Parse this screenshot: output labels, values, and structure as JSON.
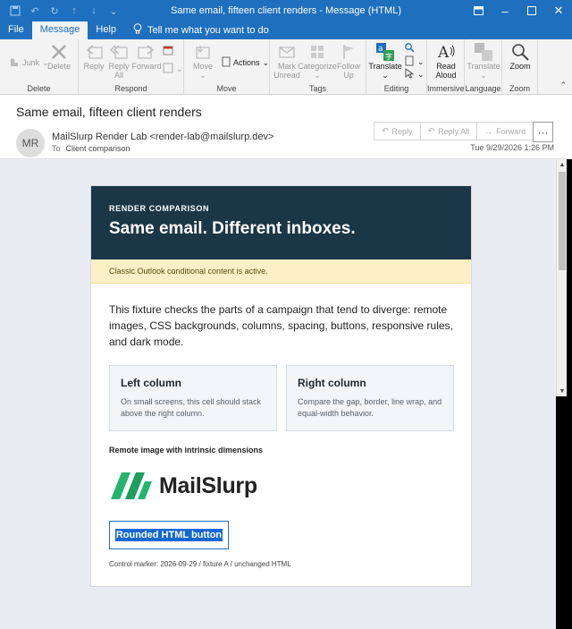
{
  "window": {
    "title": "Same email, fifteen client renders  -  Message (HTML)"
  },
  "menu_tabs": [
    {
      "label": "File",
      "active": false
    },
    {
      "label": "Message",
      "active": true
    },
    {
      "label": "Help",
      "active": false
    }
  ],
  "tell_me": "Tell me what you want to do",
  "ribbon": {
    "groups": {
      "delete": "Delete",
      "respond": "Respond",
      "move": "Move",
      "tags": "Tags",
      "editing": "Editing",
      "immersive": "Immersive",
      "language": "Language",
      "zoom": "Zoom"
    },
    "junk": "Junk",
    "delete": "Delete",
    "reply": "Reply",
    "reply_all_1": "Reply",
    "reply_all_2": "All",
    "forward": "Forward",
    "move": "Move",
    "actions": "Actions",
    "mark_unread_1": "Mark",
    "mark_unread_2": "Unread",
    "categorize": "Categorize",
    "follow_up_1": "Follow",
    "follow_up_2": "Up",
    "translate": "Translate",
    "read_aloud_1": "Read",
    "read_aloud_2": "Aloud",
    "translate_lang": "Translate",
    "zoom": "Zoom"
  },
  "message": {
    "subject": "Same email, fifteen client renders",
    "avatar_initials": "MR",
    "sender": "MailSlurp Render Lab <render-lab@mailslurp.dev>",
    "to_label": "To",
    "to_value": "Client comparison",
    "date": "Tue 9/29/2026 1:26 PM",
    "reply": "Reply",
    "reply_all": "Reply All",
    "forward": "Forward",
    "more": "···"
  },
  "email": {
    "eyebrow": "RENDER COMPARISON",
    "headline": "Same email. Different inboxes.",
    "notice": "Classic Outlook conditional content is active.",
    "intro": "This fixture checks the parts of a campaign that tend to diverge: remote images, CSS backgrounds, columns, spacing, buttons, responsive rules, and dark mode.",
    "left_col": {
      "title": "Left column",
      "body": "On small screens, this cell should stack above the right column."
    },
    "right_col": {
      "title": "Right column",
      "body": "Compare the gap, border, line wrap, and equal-width behavior."
    },
    "image_caption": "Remote image with intrinsic dimensions",
    "logo_word": "MailSlurp",
    "cta": "Rounded HTML button",
    "marker": "Control marker: 2026-09-29 / fixture A / unchanged HTML"
  },
  "colors": {
    "titlebar": "#1e6fbe",
    "hero": "#1b3646",
    "notice": "#fdf0c6",
    "logo_green": "#1fae6b"
  }
}
